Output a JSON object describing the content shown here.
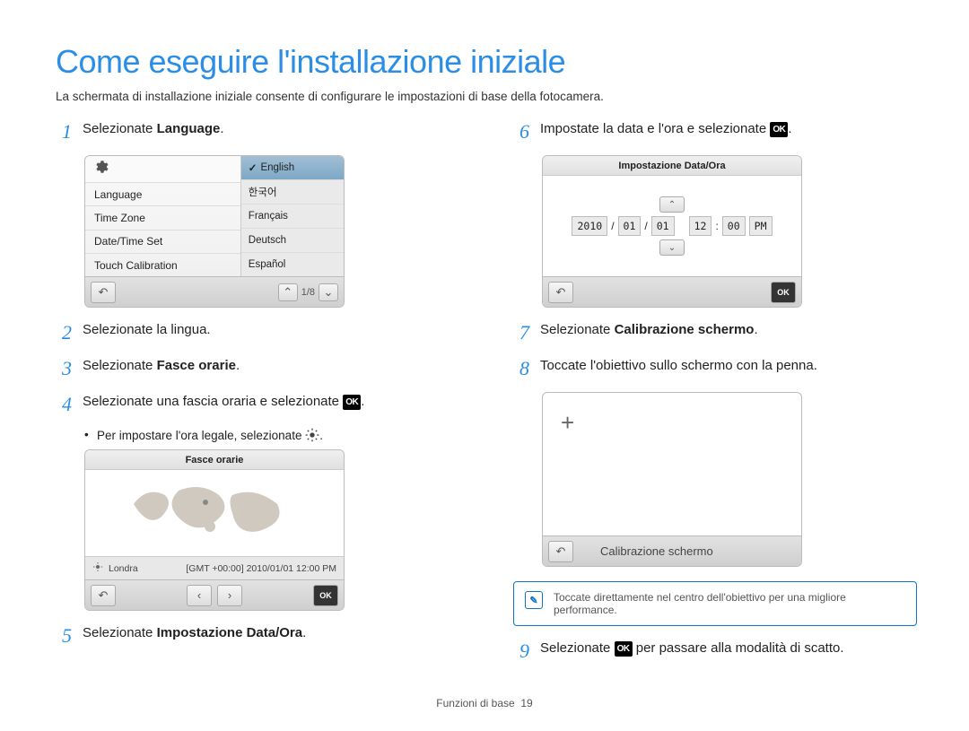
{
  "title": "Come eseguire l'installazione iniziale",
  "subtitle": "La schermata di installazione iniziale consente di configurare le impostazioni di base della fotocamera.",
  "steps": {
    "s1": {
      "num": "1",
      "pre": "Selezionate ",
      "bold": "Language",
      "post": "."
    },
    "s2": {
      "num": "2",
      "text": "Selezionate la lingua."
    },
    "s3": {
      "num": "3",
      "pre": "Selezionate ",
      "bold": "Fasce orarie",
      "post": "."
    },
    "s4": {
      "num": "4",
      "text": "Selezionate una fascia oraria e selezionate ",
      "post": "."
    },
    "s4_bullet": "Per impostare l'ora legale, selezionate ",
    "s5": {
      "num": "5",
      "pre": "Selezionate ",
      "bold": "Impostazione Data/Ora",
      "post": "."
    },
    "s6": {
      "num": "6",
      "text": "Impostate la data e l'ora e selezionate ",
      "post": "."
    },
    "s7": {
      "num": "7",
      "pre": "Selezionate ",
      "bold": "Calibrazione schermo",
      "post": "."
    },
    "s8": {
      "num": "8",
      "text": "Toccate l'obiettivo sullo schermo con la penna."
    },
    "s9": {
      "num": "9",
      "pre": "Selezionate ",
      "post": " per passare alla modalità di scatto."
    }
  },
  "lang_shot": {
    "left": [
      "Language",
      "Time Zone",
      "Date/Time Set",
      "Touch Calibration"
    ],
    "right": [
      "English",
      "한국어",
      "Français",
      "Deutsch",
      "Español"
    ],
    "pager": "1/8"
  },
  "tz_shot": {
    "title": "Fasce orarie",
    "city": "Londra",
    "status": "[GMT +00:00] 2010/01/01 12:00 PM"
  },
  "dt_shot": {
    "title": "Impostazione Data/Ora",
    "fields": [
      "2010",
      "01",
      "01",
      "12",
      "00",
      "PM"
    ],
    "sep_date": "/",
    "sep_time": ":"
  },
  "cal_shot": {
    "footer_label": "Calibrazione schermo"
  },
  "note": "Toccate direttamente nel centro dell'obiettivo per una migliore performance.",
  "footer": {
    "section": "Funzioni di base",
    "page": "19"
  },
  "icons": {
    "ok": "OK"
  }
}
